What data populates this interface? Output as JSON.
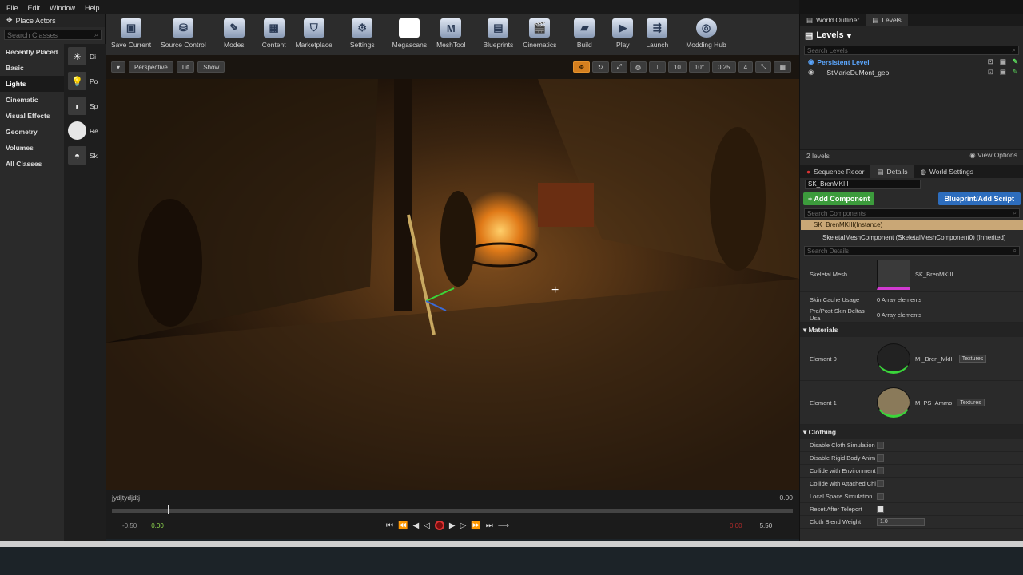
{
  "menu": [
    "File",
    "Edit",
    "Window",
    "Help"
  ],
  "place_actors": {
    "title": "Place Actors",
    "search_placeholder": "Search Classes",
    "categories": [
      "Recently Placed",
      "Basic",
      "Lights",
      "Cinematic",
      "Visual Effects",
      "Geometry",
      "Volumes",
      "All Classes"
    ],
    "active_category": "Lights",
    "items": [
      "Di",
      "Po",
      "Sp",
      "Re",
      "Sk"
    ]
  },
  "toolbar": [
    {
      "label": "Save Current",
      "icon": "save-icon"
    },
    {
      "label": "Source Control",
      "icon": "source-control-icon"
    },
    {
      "label": "Modes",
      "icon": "modes-icon"
    },
    {
      "label": "Content",
      "icon": "content-icon"
    },
    {
      "label": "Marketplace",
      "icon": "marketplace-icon"
    },
    {
      "label": "Settings",
      "icon": "settings-icon"
    },
    {
      "label": "Megascans",
      "icon": "megascans-icon"
    },
    {
      "label": "MeshTool",
      "icon": "meshtool-icon"
    },
    {
      "label": "Blueprints",
      "icon": "blueprints-icon"
    },
    {
      "label": "Cinematics",
      "icon": "cinematics-icon"
    },
    {
      "label": "Build",
      "icon": "build-icon"
    },
    {
      "label": "Play",
      "icon": "play-icon"
    },
    {
      "label": "Launch",
      "icon": "launch-icon"
    },
    {
      "label": "Modding Hub",
      "icon": "modding-hub-icon"
    }
  ],
  "viewport": {
    "perspective": "Perspective",
    "lit": "Lit",
    "show": "Show",
    "grid": "10",
    "angle": "10°",
    "scale": "0.25",
    "camera_speed": "4"
  },
  "timeline": {
    "sequence_name": "jydjtydjdtj",
    "end_time": "0.00",
    "start": "-0.50",
    "current": "0.00",
    "out_marker": "0.00",
    "end": "5.50"
  },
  "world_outliner": {
    "tab1": "World Outliner",
    "tab2": "Levels",
    "title": "Levels",
    "search_placeholder": "Search Levels",
    "levels": [
      "Persistent Level",
      "StMarieDuMont_geo"
    ],
    "count": "2 levels",
    "view_options": "View Options"
  },
  "details": {
    "tabs": [
      "Sequence Recor",
      "Details",
      "World Settings"
    ],
    "actor_name": "SK_BrenMKIII",
    "add_component": "+ Add Component",
    "blueprint_script": "Blueprint/Add Script",
    "search_components": "Search Components",
    "instance": "SK_BrenMKIII(Instance)",
    "component": "SkeletalMeshComponent (SkeletalMeshComponent0) (Inherited)",
    "search_details": "Search Details",
    "skeletal_mesh_label": "Skeletal Mesh",
    "skeletal_mesh_value": "SK_BrenMKIII",
    "skin_cache": "Skin Cache Usage",
    "skin_cache_val": "0 Array elements",
    "skin_deltas": "Pre/Post Skin Deltas Usa",
    "skin_deltas_val": "0 Array elements",
    "materials_section": "Materials",
    "element0": "Element 0",
    "element0_val": "MI_Bren_MkIII",
    "element1": "Element 1",
    "element1_val": "M_PS_Ammo",
    "textures": "Textures",
    "clothing_section": "Clothing",
    "clothing": [
      {
        "label": "Disable Cloth Simulation",
        "checked": false
      },
      {
        "label": "Disable Rigid Body Anim",
        "checked": false
      },
      {
        "label": "Collide with Environment",
        "checked": false
      },
      {
        "label": "Collide with Attached Chi",
        "checked": false
      },
      {
        "label": "Local Space Simulation",
        "checked": false
      },
      {
        "label": "Reset After Teleport",
        "checked": true
      }
    ],
    "cloth_blend": "Cloth Blend Weight",
    "cloth_blend_val": "1.0"
  }
}
